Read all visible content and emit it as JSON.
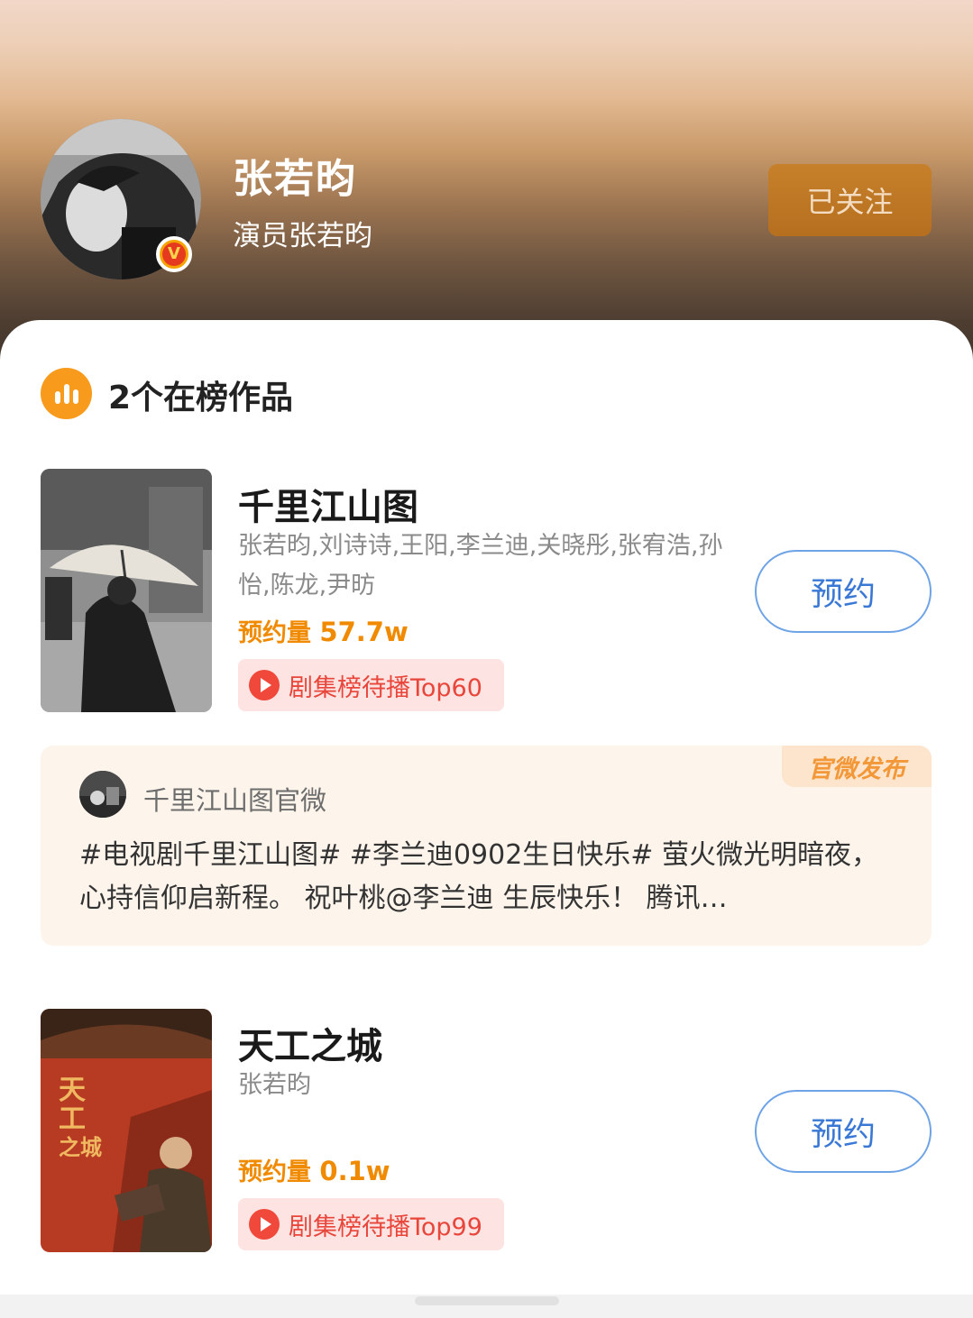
{
  "profile": {
    "name": "张若昀",
    "subtitle": "演员张若昀",
    "verified_badge": "V",
    "follow_label": "已关注"
  },
  "section": {
    "icon": "bar-chart-icon",
    "title": "2个在榜作品"
  },
  "works": [
    {
      "title": "千里江山图",
      "cast": "张若昀,刘诗诗,王阳,李兰迪,关晓彤,张宥浩,孙怡,陈龙,尹昉",
      "reserve_label": "预约量",
      "reserve_value": "57.7w",
      "rank_label": "剧集榜待播Top60",
      "button_label": "预约"
    },
    {
      "title": "天工之城",
      "cast": "张若昀",
      "reserve_label": "预约量",
      "reserve_value": "0.1w",
      "rank_label": "剧集榜待播Top99",
      "button_label": "预约"
    }
  ],
  "post": {
    "badge": "官微发布",
    "author": "千里江山图官微",
    "text": "#电视剧千里江山图# #李兰迪0902生日快乐# 萤火微光明暗夜，心持信仰启新程。 祝叶桃@李兰迪 生辰快乐！ 腾讯…"
  },
  "colors": {
    "accent_orange": "#f08a00",
    "button_blue": "#3a78d6",
    "rank_red": "#e8453b",
    "follow_bg": "#c7802a"
  }
}
